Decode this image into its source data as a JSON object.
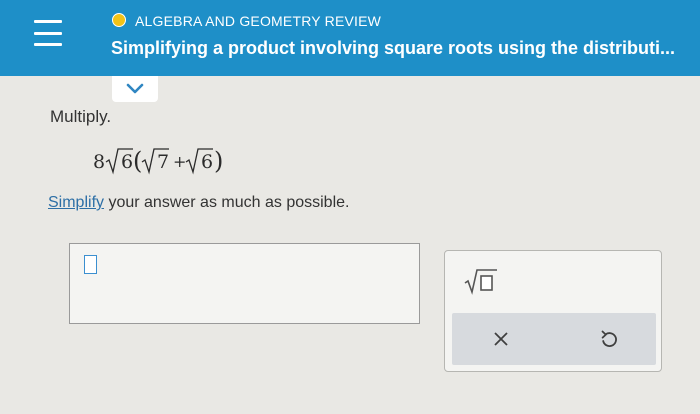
{
  "header": {
    "topic": "ALGEBRA AND GEOMETRY REVIEW",
    "title": "Simplifying a product involving square roots using the distributi...",
    "status_color": "#f2c318",
    "bar_color": "#1e8fc8",
    "menu_icon": "hamburger-menu-icon",
    "collapse_icon": "chevron-down-icon"
  },
  "question": {
    "instruction": "Multiply.",
    "expression": {
      "coefficient": "8",
      "outer_radicand": "6",
      "term1_radicand": "7",
      "operator": "+",
      "term2_radicand": "6"
    },
    "simplify_link": "Simplify",
    "simplify_rest": " your answer as much as possible."
  },
  "answer": {
    "value": ""
  },
  "tools": {
    "sqrt_icon": "square-root-icon",
    "clear_icon": "x-icon",
    "undo_icon": "undo-icon"
  }
}
